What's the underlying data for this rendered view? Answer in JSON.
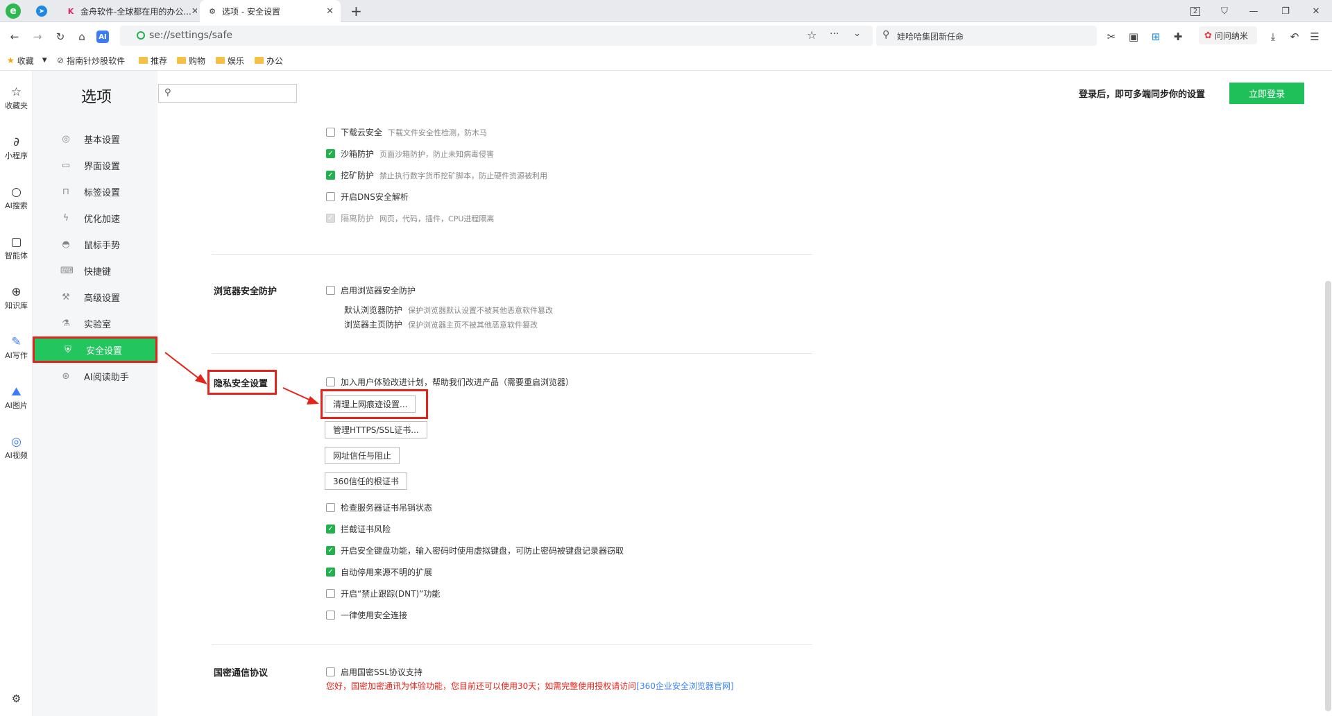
{
  "tabs": [
    {
      "label": "金舟软件-全球都在用的办公...",
      "active": false
    },
    {
      "label": "选项 - 安全设置",
      "active": true
    }
  ],
  "tabbar": {
    "new_tab": "+",
    "badge": "2"
  },
  "address": {
    "url": "se://settings/safe",
    "search_text": "娃哈哈集团新任命"
  },
  "toolbar": {
    "ext_label": "问问纳米"
  },
  "bookmarks": [
    "收藏",
    "指南针炒股软件",
    "推荐",
    "购物",
    "娱乐",
    "办公"
  ],
  "left_sidebar": [
    "收藏夹",
    "小程序",
    "AI搜索",
    "智能体",
    "知识库",
    "AI写作",
    "AI图片",
    "AI视频"
  ],
  "settings": {
    "title": "选项",
    "menu": [
      "基本设置",
      "界面设置",
      "标签设置",
      "优化加速",
      "鼠标手势",
      "快捷键",
      "高级设置",
      "实验室",
      "安全设置",
      "AI阅读助手"
    ],
    "selected": "安全设置"
  },
  "header": {
    "sync_text": "登录后，即可多端同步你的设置",
    "login_button": "立即登录"
  },
  "top_options": [
    {
      "label": "下载云安全",
      "desc": "下载文件安全性检测，防木马",
      "checked": false,
      "disabled": false
    },
    {
      "label": "沙箱防护",
      "desc": "页面沙箱防护，防止未知病毒侵害",
      "checked": true,
      "disabled": false
    },
    {
      "label": "挖矿防护",
      "desc": "禁止执行数字货币挖矿脚本，防止硬件资源被利用",
      "checked": true,
      "disabled": false
    },
    {
      "label": "开启DNS安全解析",
      "desc": "",
      "checked": false,
      "disabled": false
    },
    {
      "label": "隔离防护",
      "desc": "网页，代码，插件，CPU进程隔离",
      "checked": true,
      "disabled": true
    }
  ],
  "browser_protect": {
    "section": "浏览器安全防护",
    "option": "启用浏览器安全防护",
    "sub1": "默认浏览器防护",
    "sub1_desc": "保护浏览器默认设置不被其他恶意软件篡改",
    "sub2": "浏览器主页防护",
    "sub2_desc": "保护浏览器主页不被其他恶意软件篡改"
  },
  "privacy": {
    "section": "隐私安全设置",
    "join_plan": "加入用户体验改进计划，帮助我们改进产品（需要重启浏览器）",
    "buttons": [
      "清理上网痕迹设置...",
      "管理HTTPS/SSL证书...",
      "网址信任与阻止",
      "360信任的根证书"
    ],
    "options": [
      {
        "label": "检查服务器证书吊销状态",
        "checked": false
      },
      {
        "label": "拦截证书风险",
        "checked": true
      },
      {
        "label": "开启安全键盘功能，输入密码时使用虚拟键盘，可防止密码被键盘记录器窃取",
        "checked": true
      },
      {
        "label": "自动停用来源不明的扩展",
        "checked": true
      },
      {
        "label": "开启“禁止跟踪(DNT)”功能",
        "checked": false
      },
      {
        "label": "一律使用安全连接",
        "checked": false
      }
    ]
  },
  "guomi": {
    "section": "国密通信协议",
    "option": "启用国密SSL协议支持",
    "warning": "您好，国密加密通讯为体验功能，您目前还可以使用30天；如需完整使用授权请访问",
    "link": "[360企业安全浏览器官网]"
  },
  "colors": {
    "accent_green": "#22c55e",
    "login_green": "#1fbf5a",
    "annotation_red": "#e5231a",
    "link_blue": "#3b82f6"
  }
}
